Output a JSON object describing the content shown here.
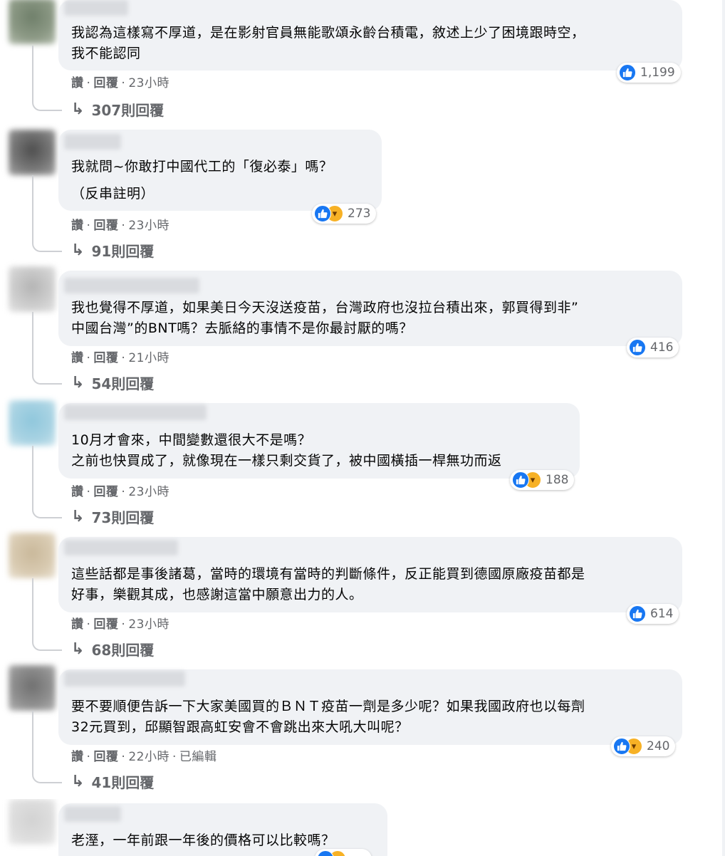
{
  "colors": {
    "bubble": "#f0f2f5",
    "like": "#1877f2",
    "haha": "#f7b125",
    "meta": "#65676b"
  },
  "comments": [
    {
      "lines": [
        "我認為這樣寫不厚道，是在影射官員無能歌頌永齡台積電，敘述上少了困境跟時空，",
        "我不能認同"
      ],
      "reaction_icons": [
        "like-icon"
      ],
      "reaction_count": "1,199",
      "like": "讚",
      "reply": "回覆",
      "time": "23小時",
      "edited": "",
      "replies_label": "307則回覆"
    },
    {
      "lines": [
        "我就問~你敢打中國代工的「復必泰」嗎？",
        "（反串註明）"
      ],
      "reaction_icons": [
        "like-icon",
        "haha-icon"
      ],
      "reaction_count": "273",
      "like": "讚",
      "reply": "回覆",
      "time": "23小時",
      "edited": "",
      "replies_label": "91則回覆"
    },
    {
      "lines": [
        "我也覺得不厚道，如果美日今天沒送疫苗，台灣政府也沒拉台積出來，郭買得到非”",
        "中國台灣”的BNT嗎？去脈絡的事情不是你最討厭的嗎？"
      ],
      "reaction_icons": [
        "like-icon"
      ],
      "reaction_count": "416",
      "like": "讚",
      "reply": "回覆",
      "time": "21小時",
      "edited": "",
      "replies_label": "54則回覆"
    },
    {
      "lines": [
        "10月才會來，中間變數還很大不是嗎？",
        "之前也快買成了，就像現在一樣只剩交貨了，被中國橫插一桿無功而返"
      ],
      "reaction_icons": [
        "like-icon",
        "haha-icon"
      ],
      "reaction_count": "188",
      "like": "讚",
      "reply": "回覆",
      "time": "23小時",
      "edited": "",
      "replies_label": "73則回覆"
    },
    {
      "lines": [
        "這些話都是事後諸葛，當時的環境有當時的判斷條件，反正能買到德國原廠疫苗都是",
        "好事，樂觀其成，也感謝這當中願意出力的人。"
      ],
      "reaction_icons": [
        "like-icon"
      ],
      "reaction_count": "614",
      "like": "讚",
      "reply": "回覆",
      "time": "23小時",
      "edited": "",
      "replies_label": "68則回覆"
    },
    {
      "lines": [
        "要不要順便告訴一下大家美國買的ＢＮＴ疫苗一劑是多少呢？如果我國政府也以每劑",
        "32元買到，邱顯智跟高虹安會不會跳出來大吼大叫呢？"
      ],
      "reaction_icons": [
        "like-icon",
        "haha-icon"
      ],
      "reaction_count": "240",
      "like": "讚",
      "reply": "回覆",
      "time": "22小時",
      "edited": "已編輯",
      "replies_label": "41則回覆"
    },
    {
      "lines": [
        "老溼，一年前跟一年後的價格可以比較嗎？"
      ],
      "reaction_icons": [],
      "reaction_count": "",
      "like": "",
      "reply": "",
      "time": "",
      "edited": "",
      "replies_label": ""
    }
  ]
}
